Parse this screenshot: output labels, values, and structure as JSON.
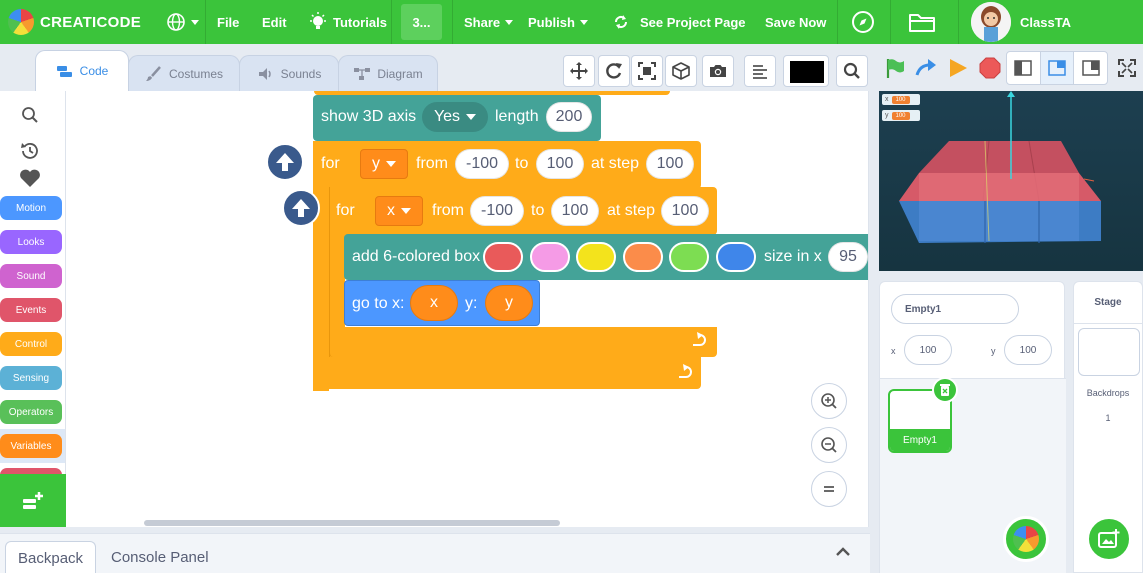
{
  "app": {
    "brand": "CREATICODE"
  },
  "menu": {
    "file": "File",
    "edit": "Edit",
    "tutorials": "Tutorials",
    "project_title": "3...",
    "share": "Share",
    "publish": "Publish",
    "see_project_page": "See Project Page",
    "save_now": "Save Now",
    "username": "ClassTA"
  },
  "tabs": [
    {
      "label": "Code"
    },
    {
      "label": "Costumes"
    },
    {
      "label": "Sounds"
    },
    {
      "label": "Diagram"
    }
  ],
  "categories": [
    {
      "label": "Motion",
      "color": "#4c97ff"
    },
    {
      "label": "Looks",
      "color": "#9966ff"
    },
    {
      "label": "Sound",
      "color": "#cf63cf"
    },
    {
      "label": "Events",
      "color": "#e0556a"
    },
    {
      "label": "Control",
      "color": "#ffab19"
    },
    {
      "label": "Sensing",
      "color": "#5cb1d6"
    },
    {
      "label": "Operators",
      "color": "#59c059"
    },
    {
      "label": "Variables",
      "color": "#ff8c1a"
    }
  ],
  "blocks": {
    "show_axis": {
      "text": "show 3D axis",
      "option": "Yes",
      "length_label": "length",
      "length_value": "200"
    },
    "for_y": {
      "label": "for",
      "var": "y",
      "from_label": "from",
      "from_value": "-100",
      "to_label": "to",
      "to_value": "100",
      "step_label": "at step",
      "step_value": "100"
    },
    "for_x": {
      "label": "for",
      "var": "x",
      "from_label": "from",
      "from_value": "-100",
      "to_label": "to",
      "to_value": "100",
      "step_label": "at step",
      "step_value": "100"
    },
    "add_box": {
      "text": "add 6-colored box",
      "colors": [
        "#e95a5a",
        "#f59be6",
        "#f3e31c",
        "#fb8c4a",
        "#7ddd52",
        "#3f86ea"
      ],
      "size_label": "size in x",
      "size_value": "95"
    },
    "goto": {
      "label": "go to x:",
      "x_var": "x",
      "y_label": "y:",
      "y_var": "y"
    }
  },
  "bottom_tabs": {
    "backpack": "Backpack",
    "console": "Console Panel"
  },
  "stage": {
    "monitor_x_label": "x",
    "monitor_x_value": "100",
    "monitor_y_label": "y",
    "monitor_y_value": "100"
  },
  "sprite": {
    "name": "Empty1",
    "x_label": "x",
    "x_value": "100",
    "y_label": "y",
    "y_value": "100",
    "thumb_name": "Empty1"
  },
  "stage_pane": {
    "title": "Stage",
    "backdrops_label": "Backdrops",
    "backdrops_count": "1"
  }
}
